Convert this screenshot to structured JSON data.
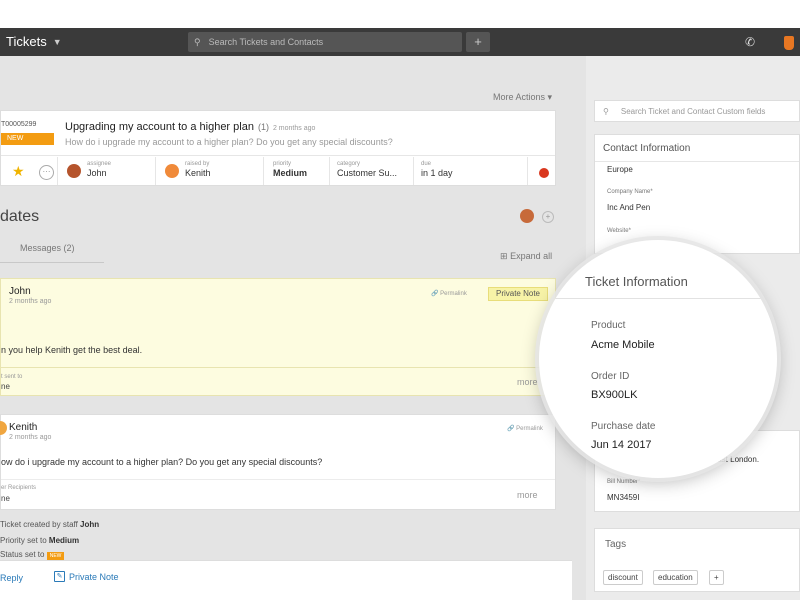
{
  "header": {
    "brand": "Tickets",
    "search_placeholder": "Search Tickets and Contacts",
    "add": "+"
  },
  "ticket": {
    "more_actions": "More Actions",
    "id": "T00005299",
    "status_badge": "NEW",
    "title": "Upgrading my account to a higher plan",
    "thread_count": "(1)",
    "time": "2 months ago",
    "description": "How do i upgrade my account to a higher plan? Do you get any special discounts?",
    "fields": [
      {
        "label": "assignee",
        "value": "John"
      },
      {
        "label": "raised by",
        "value": "Kenith"
      },
      {
        "label": "priority",
        "value": "Medium"
      },
      {
        "label": "category",
        "value": "Customer Su..."
      },
      {
        "label": "due",
        "value": "in 1 day"
      }
    ]
  },
  "updates": {
    "title": "dates",
    "tab_messages": "Messages (2)",
    "expand_all": "Expand all"
  },
  "note": {
    "author": "John",
    "time": "2 months ago",
    "permalink": "Permalink",
    "tag": "Private Note",
    "body": "n you help Kenith get the best deal.",
    "sent_label": "t sent to",
    "sent_value": "ne",
    "more": "more"
  },
  "message": {
    "author": "Kenith",
    "time": "2 months ago",
    "permalink": "Permalink",
    "body": "ow do i upgrade my account to a higher plan? Do you get any special discounts?",
    "recipients_label": "er Recipients",
    "recipients_value": "ne",
    "more": "more"
  },
  "activity": {
    "created_prefix": "Ticket created by staff ",
    "created_by": "John",
    "priority_prefix": "Priority set to ",
    "priority_value": "Medium",
    "status_prefix": "Status set to ",
    "status_value": "NEW"
  },
  "reply_bar": {
    "reply": "Reply",
    "private_note": "Private Note"
  },
  "right_panel": {
    "search_placeholder": "Search Ticket and Contact Custom fields",
    "contact_title": "Contact Information",
    "region": "Europe",
    "company_label": "Company Name*",
    "company_value": "Inc And Pen",
    "website_label": "Website*",
    "address_fragment": "d, East London.",
    "bill_label": "Bill Number*",
    "bill_value": "MN3459I",
    "tags_title": "Tags",
    "tags": [
      "discount",
      "education",
      "+"
    ]
  },
  "magnifier": {
    "title": "Ticket Information",
    "product_label": "Product",
    "product_value": "Acme Mobile",
    "order_label": "Order ID",
    "order_value": "BX900LK",
    "purchase_label": "Purchase date",
    "purchase_value": "Jun 14 2017"
  }
}
